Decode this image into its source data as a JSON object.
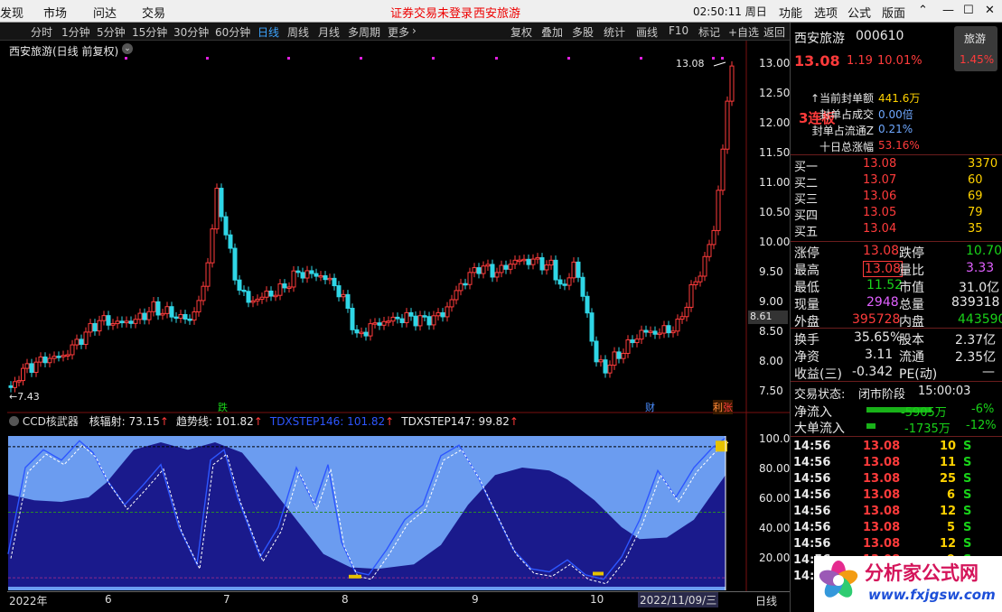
{
  "menu": {
    "items": [
      "发现",
      "市场",
      "问达",
      "交易"
    ],
    "login_notice": "证券交易未登录",
    "stock_tag": "西安旅游",
    "clock": "02:50:11 周日",
    "right_items": [
      "功能",
      "选项",
      "公式",
      "版面"
    ]
  },
  "toolbar": {
    "periods": [
      "分时",
      "1分钟",
      "5分钟",
      "15分钟",
      "30分钟",
      "60分钟",
      "日线",
      "周线",
      "月线",
      "多周期",
      "更多"
    ],
    "active_period": "日线",
    "right_items": [
      "复权",
      "叠加",
      "多股",
      "统计",
      "画线",
      "F10",
      "标记",
      "+自选",
      "返回"
    ]
  },
  "chart": {
    "title": "西安旅游(日线 前复权)",
    "high_label": "13.08",
    "low_label": "7.43",
    "current_price_label": "8.61",
    "price_axis": [
      "13.00",
      "12.50",
      "12.00",
      "11.50",
      "11.00",
      "10.50",
      "10.00",
      "9.50",
      "9.00",
      "8.50",
      "8.00",
      "7.50"
    ],
    "events": [
      {
        "label": "跌",
        "color": "#19d219"
      },
      {
        "label": "财",
        "color": "#4a8dff"
      },
      {
        "label": "利",
        "color": "#ff8a3a"
      },
      {
        "label": "张",
        "color": "#ff3b3b"
      }
    ]
  },
  "indicator": {
    "name": "CCD核武器",
    "fields": [
      {
        "label": "核辐射:",
        "value": "73.15",
        "arrow": "↑",
        "color": "#e8e8e8"
      },
      {
        "label": "趋势线:",
        "value": "101.82",
        "arrow": "↑",
        "color": "#e8e8e8"
      },
      {
        "label": "TDXSTEP146:",
        "value": "101.82",
        "arrow": "↑",
        "color": "#2d56ff"
      },
      {
        "label": "TDXSTEP147:",
        "value": "99.82",
        "arrow": "↑",
        "color": "#e8e8e8"
      }
    ],
    "axis": [
      "100.00",
      "80.00",
      "60.00",
      "40.00",
      "20.00"
    ]
  },
  "xaxis": {
    "labels": [
      "2022年",
      "6",
      "7",
      "8",
      "9",
      "10"
    ],
    "cursor_date": "2022/11/09/三",
    "period_tag": "日线"
  },
  "quote": {
    "name": "西安旅游",
    "code": "000610",
    "price": "13.08",
    "change": "1.19",
    "pct": "10.01%",
    "sector": "旅游",
    "sector_pct": "1.45%",
    "board_tag": "3连板",
    "seal": [
      {
        "label": "当前封单额",
        "value": "441.6万"
      },
      {
        "label": "封单占成交",
        "value": "0.00倍"
      },
      {
        "label": "封单占流通Z",
        "value": "0.21%"
      },
      {
        "label": "十日总涨幅",
        "value": "53.16%"
      }
    ],
    "bids": [
      {
        "label": "买一",
        "price": "13.08",
        "vol": "3370"
      },
      {
        "label": "买二",
        "price": "13.07",
        "vol": "60"
      },
      {
        "label": "买三",
        "price": "13.06",
        "vol": "69"
      },
      {
        "label": "买四",
        "price": "13.05",
        "vol": "79"
      },
      {
        "label": "买五",
        "price": "13.04",
        "vol": "35"
      }
    ],
    "stats": [
      {
        "l1": "涨停",
        "v1": "13.08",
        "l2": "跌停",
        "v2": "10.70"
      },
      {
        "l1": "最高",
        "v1": "13.08",
        "l2": "量比",
        "v2": "3.33"
      },
      {
        "l1": "最低",
        "v1": "11.52",
        "l2": "市值",
        "v2": "31.0亿"
      },
      {
        "l1": "现量",
        "v1": "2948",
        "l2": "总量",
        "v2": "839318"
      },
      {
        "l1": "外盘",
        "v1": "395728",
        "l2": "内盘",
        "v2": "443590"
      }
    ],
    "stats2": [
      {
        "l1": "换手",
        "v1": "35.65%",
        "l2": "股本",
        "v2": "2.37亿"
      },
      {
        "l1": "净资",
        "v1": "3.11",
        "l2": "流通",
        "v2": "2.35亿"
      },
      {
        "l1": "收益(三)",
        "v1": "-0.342",
        "l2": "PE(动)",
        "v2": "—"
      }
    ],
    "trade_status_label": "交易状态:",
    "trade_status": "闭市阶段",
    "trade_time": "15:00:03",
    "flows": [
      {
        "label": "净流入",
        "value": "-5905万",
        "pct": "-6%"
      },
      {
        "label": "大单流入",
        "value": "-1735万",
        "pct": "-12%"
      }
    ],
    "ticks": [
      {
        "time": "14:56",
        "price": "13.08",
        "vol": "10",
        "side": "S"
      },
      {
        "time": "14:56",
        "price": "13.08",
        "vol": "11",
        "side": "S"
      },
      {
        "time": "14:56",
        "price": "13.08",
        "vol": "25",
        "side": "S"
      },
      {
        "time": "14:56",
        "price": "13.08",
        "vol": "6",
        "side": "S"
      },
      {
        "time": "14:56",
        "price": "13.08",
        "vol": "12",
        "side": "S"
      },
      {
        "time": "14:56",
        "price": "13.08",
        "vol": "5",
        "side": "S"
      },
      {
        "time": "14:56",
        "price": "13.08",
        "vol": "12",
        "side": "S"
      },
      {
        "time": "14:56",
        "price": "13.08",
        "vol": "9",
        "side": "S"
      },
      {
        "time": "14:56",
        "price": "13.08",
        "vol": "",
        "side": ""
      }
    ]
  },
  "watermark": {
    "brand": "分析家公式网",
    "url": "www.fxjgsw.com"
  }
}
